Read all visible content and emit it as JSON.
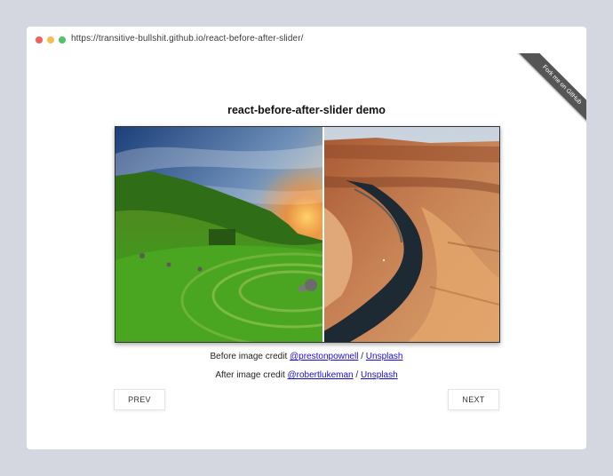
{
  "browser": {
    "url": "https://transitive-bullshit.github.io/react-before-after-slider/"
  },
  "ribbon": {
    "label": "Fork me on GitHub"
  },
  "page": {
    "title": "react-before-after-slider demo"
  },
  "slider": {
    "position": 0.54
  },
  "credits": {
    "before": {
      "prefix": "Before image credit ",
      "author": "@prestonpownell",
      "separator": " / ",
      "source": "Unsplash"
    },
    "after": {
      "prefix": "After image credit ",
      "author": "@robertlukeman",
      "separator": " / ",
      "source": "Unsplash"
    }
  },
  "nav": {
    "prev_label": "PREV",
    "next_label": "NEXT"
  },
  "colors": {
    "link": "#1a0dcc",
    "ribbon": "#555555"
  }
}
